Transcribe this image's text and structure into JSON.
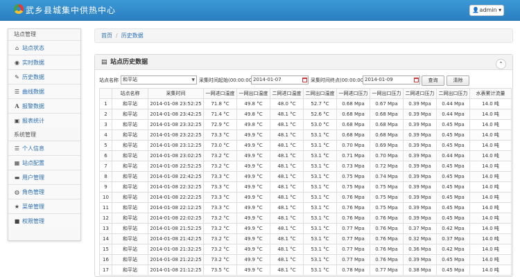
{
  "header": {
    "title": "武乡县城集中供热中心",
    "user": "admin"
  },
  "sidebar": {
    "sections": [
      {
        "label": "站点管理",
        "items": [
          {
            "label": "站点状态",
            "icon": "home-icon"
          },
          {
            "label": "实时数据",
            "icon": "eye-icon"
          },
          {
            "label": "历史数据",
            "icon": "edit-icon"
          },
          {
            "label": "曲线数据",
            "icon": "list-icon"
          },
          {
            "label": "报警数据",
            "icon": "font-icon"
          },
          {
            "label": "报表统计",
            "icon": "picture-icon"
          }
        ]
      },
      {
        "label": "系统管理",
        "items": [
          {
            "label": "个人信息",
            "icon": "list-icon"
          },
          {
            "label": "站点配置",
            "icon": "grid-icon"
          },
          {
            "label": "用户管理",
            "icon": "folder-icon"
          },
          {
            "label": "角色管理",
            "icon": "globe-icon"
          },
          {
            "label": "菜单管理",
            "icon": "star-icon"
          },
          {
            "label": "权限管理",
            "icon": "lock-icon"
          }
        ]
      }
    ]
  },
  "breadcrumb": {
    "home": "首页",
    "current": "历史数据"
  },
  "panel": {
    "title": "站点历史数据"
  },
  "filters": {
    "station_label": "站点名称",
    "station_value": "和平站",
    "start_label": "采集时间起始(00:00:00)",
    "start_value": "2014-01-07",
    "end_label": "采集时间终点(00:00:00)",
    "end_value": "2014-01-09",
    "query_button": "查询",
    "clear_button": "清除"
  },
  "table": {
    "columns": [
      "",
      "站点名称",
      "采集时间",
      "一网进口温度",
      "一网出口温度",
      "二网进口温度",
      "二网出口温度",
      "一网进口压力",
      "一网出口压力",
      "二网进口压力",
      "二网出口压力",
      "水表累计流量"
    ],
    "rows": [
      [
        "1",
        "和平站",
        "2014-01-08 23:52:25",
        "71.8 °C",
        "49.8 °C",
        "48.0 °C",
        "52.7 °C",
        "0.68 Mpa",
        "0.67 Mpa",
        "0.39 Mpa",
        "0.44 Mpa",
        "14.0 吨"
      ],
      [
        "2",
        "和平站",
        "2014-01-08 23:42:25",
        "71.4 °C",
        "49.8 °C",
        "48.1 °C",
        "52.6 °C",
        "0.68 Mpa",
        "0.68 Mpa",
        "0.39 Mpa",
        "0.44 Mpa",
        "14.0 吨"
      ],
      [
        "3",
        "和平站",
        "2014-01-08 23:32:25",
        "72.9 °C",
        "49.8 °C",
        "48.1 °C",
        "53.0 °C",
        "0.68 Mpa",
        "0.68 Mpa",
        "0.39 Mpa",
        "0.45 Mpa",
        "14.0 吨"
      ],
      [
        "4",
        "和平站",
        "2014-01-08 23:22:25",
        "73.3 °C",
        "49.9 °C",
        "48.1 °C",
        "53.1 °C",
        "0.68 Mpa",
        "0.68 Mpa",
        "0.39 Mpa",
        "0.45 Mpa",
        "14.0 吨"
      ],
      [
        "5",
        "和平站",
        "2014-01-08 23:12:25",
        "73.0 °C",
        "49.9 °C",
        "48.1 °C",
        "53.1 °C",
        "0.70 Mpa",
        "0.69 Mpa",
        "0.39 Mpa",
        "0.45 Mpa",
        "14.0 吨"
      ],
      [
        "6",
        "和平站",
        "2014-01-08 23:02:25",
        "73.2 °C",
        "49.9 °C",
        "48.1 °C",
        "53.1 °C",
        "0.71 Mpa",
        "0.70 Mpa",
        "0.39 Mpa",
        "0.44 Mpa",
        "14.0 吨"
      ],
      [
        "7",
        "和平站",
        "2014-01-08 22:52:25",
        "73.2 °C",
        "49.9 °C",
        "48.1 °C",
        "53.1 °C",
        "0.73 Mpa",
        "0.72 Mpa",
        "0.39 Mpa",
        "0.45 Mpa",
        "14.0 吨"
      ],
      [
        "8",
        "和平站",
        "2014-01-08 22:42:25",
        "73.3 °C",
        "49.9 °C",
        "48.1 °C",
        "53.1 °C",
        "0.75 Mpa",
        "0.74 Mpa",
        "0.39 Mpa",
        "0.45 Mpa",
        "14.0 吨"
      ],
      [
        "9",
        "和平站",
        "2014-01-08 22:32:25",
        "73.3 °C",
        "49.9 °C",
        "48.1 °C",
        "53.1 °C",
        "0.75 Mpa",
        "0.75 Mpa",
        "0.39 Mpa",
        "0.45 Mpa",
        "14.0 吨"
      ],
      [
        "10",
        "和平站",
        "2014-01-08 22:22:25",
        "73.3 °C",
        "49.9 °C",
        "48.1 °C",
        "53.1 °C",
        "0.76 Mpa",
        "0.75 Mpa",
        "0.39 Mpa",
        "0.45 Mpa",
        "14.0 吨"
      ],
      [
        "11",
        "和平站",
        "2014-01-08 22:12:25",
        "73.3 °C",
        "49.9 °C",
        "48.1 °C",
        "53.1 °C",
        "0.76 Mpa",
        "0.75 Mpa",
        "0.39 Mpa",
        "0.45 Mpa",
        "14.0 吨"
      ],
      [
        "12",
        "和平站",
        "2014-01-08 22:02:25",
        "73.2 °C",
        "49.9 °C",
        "48.1 °C",
        "53.1 °C",
        "0.76 Mpa",
        "0.76 Mpa",
        "0.39 Mpa",
        "0.45 Mpa",
        "14.0 吨"
      ],
      [
        "13",
        "和平站",
        "2014-01-08 21:52:25",
        "73.2 °C",
        "49.9 °C",
        "48.1 °C",
        "53.1 °C",
        "0.77 Mpa",
        "0.76 Mpa",
        "0.37 Mpa",
        "0.42 Mpa",
        "14.0 吨"
      ],
      [
        "14",
        "和平站",
        "2014-01-08 21:42:25",
        "73.2 °C",
        "49.9 °C",
        "48.1 °C",
        "53.1 °C",
        "0.77 Mpa",
        "0.76 Mpa",
        "0.32 Mpa",
        "0.37 Mpa",
        "14.0 吨"
      ],
      [
        "15",
        "和平站",
        "2014-01-08 21:32:25",
        "73.2 °C",
        "49.9 °C",
        "48.1 °C",
        "53.1 °C",
        "0.77 Mpa",
        "0.76 Mpa",
        "0.36 Mpa",
        "0.42 Mpa",
        "14.0 吨"
      ],
      [
        "16",
        "和平站",
        "2014-01-08 21:22:25",
        "73.2 °C",
        "49.9 °C",
        "48.1 °C",
        "53.1 °C",
        "0.77 Mpa",
        "0.76 Mpa",
        "0.39 Mpa",
        "0.45 Mpa",
        "14.0 吨"
      ],
      [
        "17",
        "和平站",
        "2014-01-08 21:12:25",
        "73.5 °C",
        "49.9 °C",
        "48.1 °C",
        "53.1 °C",
        "0.78 Mpa",
        "0.77 Mpa",
        "0.38 Mpa",
        "0.45 Mpa",
        "14.0 吨"
      ]
    ]
  }
}
